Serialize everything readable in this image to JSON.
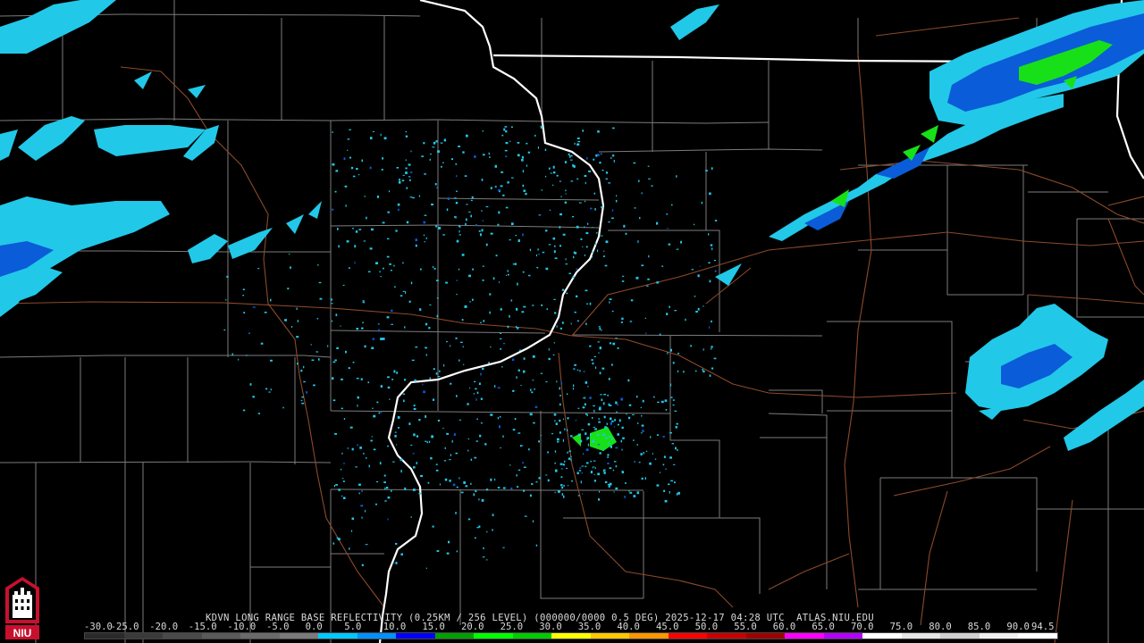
{
  "product": {
    "caption": "KDVN LONG RANGE BASE REFLECTIVITY (0.25KM / 256 LEVEL) (000000/0000 0.5 DEG) 2025-12-17 04:28 UTC  ATLAS.NIU.EDU"
  },
  "logo": {
    "label": "NIU",
    "icon": "niu-tower-logo-icon"
  },
  "legend": {
    "labels": [
      "-30.0",
      "-25.0",
      "-20.0",
      "-15.0",
      "-10.0",
      "-5.0",
      "0.0",
      "5.0",
      "10.0",
      "15.0",
      "20.0",
      "25.0",
      "30.0",
      "35.0",
      "40.0",
      "45.0",
      "50.0",
      "55.0",
      "60.0",
      "65.0",
      "70.0",
      "75.0",
      "80.0",
      "85.0",
      "90.0",
      "94.5"
    ],
    "colors": [
      "#2a2a2a",
      "#3a3a3a",
      "#4a4a4a",
      "#5a5a5a",
      "#6a6a6a",
      "#7a7a7a",
      "#00c8ff",
      "#0090ff",
      "#0000ff",
      "#00a000",
      "#00ff00",
      "#00cc00",
      "#ffff00",
      "#ffc800",
      "#ff9600",
      "#ff0000",
      "#c80000",
      "#a00000",
      "#ff00ff",
      "#b400ff",
      "#ffffff",
      "#e6e6e6",
      "#d0d0d0",
      "#f0f0f0",
      "#ffffff"
    ]
  },
  "map_colors": {
    "background": "#000000",
    "county_lines": "#8a8a8a",
    "state_lines": "#ffffff",
    "highways": "#8b4a2b",
    "light_echo": "#22c8e8",
    "moderate_echo": "#0a5cd8",
    "strong_echo": "#18e018"
  }
}
